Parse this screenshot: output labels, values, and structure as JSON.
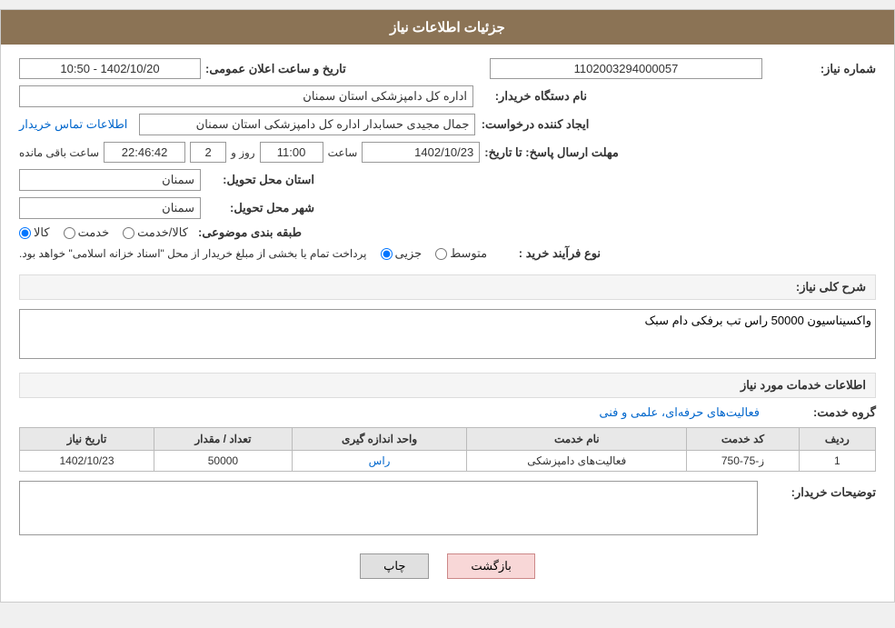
{
  "page": {
    "title": "جزئیات اطلاعات نیاز"
  },
  "header": {
    "shomara_niaz_label": "شماره نیاز:",
    "shomara_niaz_value": "1102003294000057",
    "tarikh_label": "تاریخ و ساعت اعلان عمومی:",
    "tarikh_value": "1402/10/20 - 10:50",
    "nam_dastgah_label": "نام دستگاه خریدار:",
    "nam_dastgah_value": "اداره کل دامپزشکی استان سمنان",
    "ijad_label": "ایجاد کننده درخواست:",
    "ijad_value": "جمال مجیدی حسابدار اداره کل دامپزشکی استان سمنان",
    "ettelaat_link": "اطلاعات تماس خریدار",
    "mohlat_label": "مهلت ارسال پاسخ: تا تاریخ:",
    "mohlat_date": "1402/10/23",
    "mohlat_saat_label": "ساعت",
    "mohlat_saat_value": "11:00",
    "mohlat_rooz_label": "روز و",
    "mohlat_rooz_value": "2",
    "mande_label": "ساعت باقی مانده",
    "mande_value": "22:46:42",
    "ostan_label": "استان محل تحویل:",
    "ostan_value": "سمنان",
    "shahr_label": "شهر محل تحویل:",
    "shahr_value": "سمنان",
    "tabaqe_label": "طبقه بندی موضوعی:",
    "tabaqe_kala": "کالا",
    "tabaqe_khedmat": "خدمت",
    "tabaqe_kala_khedmat": "کالا/خدمت",
    "noe_label": "نوع فرآیند خرید :",
    "noe_jozi": "جزیی",
    "noe_motevaset": "متوسط",
    "noe_notice": "پرداخت تمام یا بخشی از مبلغ خریدار از محل \"اسناد خزانه اسلامی\" خواهد بود."
  },
  "sharh": {
    "label": "شرح کلی نیاز:",
    "value": "واکسیناسیون 50000 راس تب برفکی دام سبک"
  },
  "service_info": {
    "section_title": "اطلاعات خدمات مورد نیاز",
    "group_label": "گروه خدمت:",
    "group_value": "فعالیت‌های حرفه‌ای، علمی و فنی",
    "table": {
      "headers": [
        "ردیف",
        "کد خدمت",
        "نام خدمت",
        "واحد اندازه گیری",
        "تعداد / مقدار",
        "تاریخ نیاز"
      ],
      "rows": [
        {
          "radif": "1",
          "kod": "ز-75-750",
          "name": "فعالیت‌های دامپزشکی",
          "vahed": "راس",
          "tedad": "50000",
          "tarikh": "1402/10/23"
        }
      ]
    }
  },
  "tawsiyat": {
    "label": "توضیحات خریدار:",
    "value": ""
  },
  "actions": {
    "print_label": "چاپ",
    "back_label": "بازگشت"
  }
}
